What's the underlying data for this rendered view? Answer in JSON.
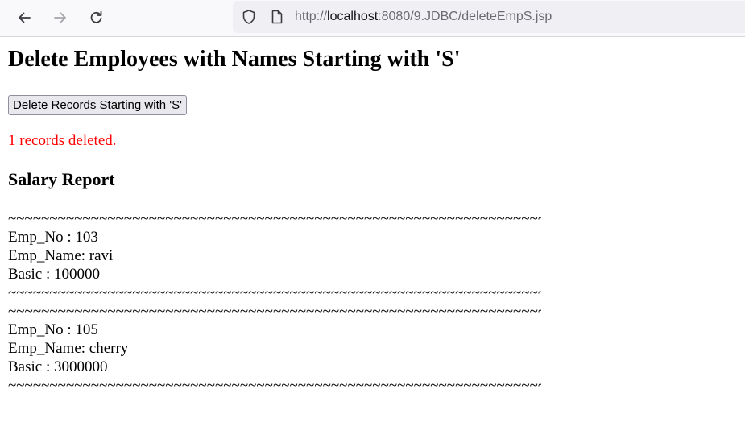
{
  "browser": {
    "url_scheme": "http://",
    "url_host": "localhost",
    "url_path": ":8080/9.JDBC/deleteEmpS.jsp",
    "icons": [
      "back-arrow-icon",
      "forward-arrow-icon",
      "reload-icon",
      "shield-icon",
      "page-icon"
    ]
  },
  "page": {
    "heading": "Delete Employees with Names Starting with 'S'",
    "button_label": "Delete Records Starting with 'S'",
    "message": "1 records deleted.",
    "message_color": "#ff0000",
    "report_heading": "Salary Report",
    "separator": "~~~~~~~~~~~~~~~~~~~~~~~~~~~~~~~~~~~~~~~~~~~~~~~~~~~~~~~~~~~~~~~~~~~~~~~~~~~~~~~~",
    "records": [
      {
        "emp_no_line": "Emp_No : 103",
        "emp_name_line": "Emp_Name: ravi",
        "basic_line": "Basic : 100000"
      },
      {
        "emp_no_line": "Emp_No : 105",
        "emp_name_line": "Emp_Name: cherry",
        "basic_line": "Basic : 3000000"
      }
    ]
  }
}
